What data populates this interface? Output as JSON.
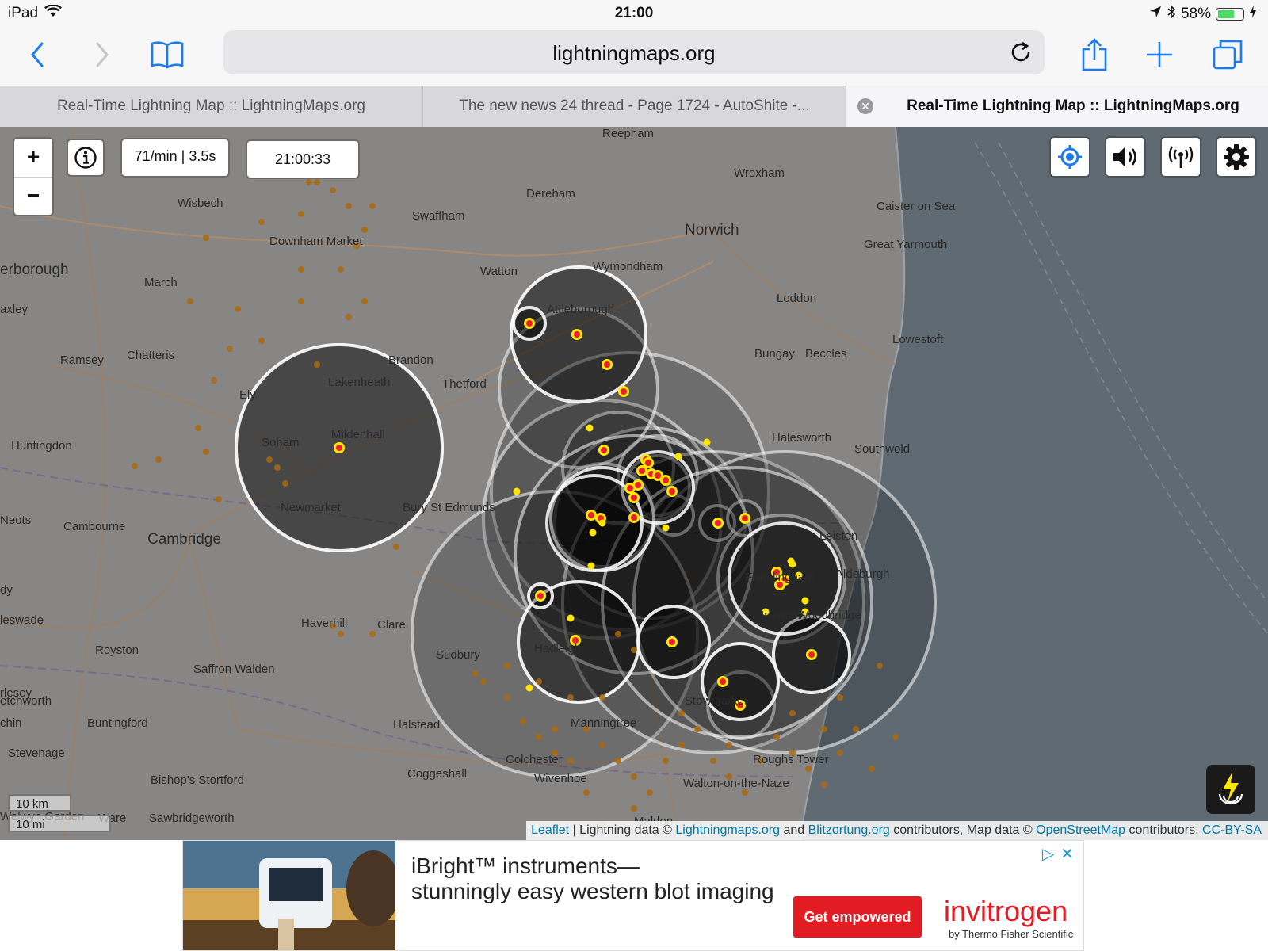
{
  "status_bar": {
    "device": "iPad",
    "time": "21:00",
    "battery_percent": "58%",
    "battery_level": 0.58
  },
  "toolbar": {
    "url": "lightningmaps.org"
  },
  "tabs": [
    {
      "label": "Real-Time Lightning Map :: LightningMaps.org",
      "active": false
    },
    {
      "label": "The new news 24 thread - Page 1724 - AutoShite -...",
      "active": false
    },
    {
      "label": "Real-Time Lightning Map :: LightningMaps.org",
      "active": true
    }
  ],
  "map": {
    "zoom_in_label": "+",
    "zoom_out_label": "−",
    "rate": "71/min | 3.5s",
    "clock": "21:00:33",
    "scale_km": "10 km",
    "scale_mi": "10 mi",
    "place_labels": [
      "Reepham",
      "Wroxham",
      "Wisbech",
      "Dereham",
      "Swaffham",
      "Caister on Sea",
      "Norwich",
      "Great Yarmouth",
      "Downham Market",
      "erborough",
      "March",
      "Watton",
      "Wymondham",
      "Loddon",
      "Attleborough",
      "axley",
      "Ramsey",
      "Chatteris",
      "Brandon",
      "Bungay",
      "Beccles",
      "Lowestoft",
      "Lakenheath",
      "Thetford",
      "Halesworth",
      "Ely",
      "Huntingdon",
      "Mildenhall",
      "Soham",
      "Southwold",
      "Neots",
      "Cambourne",
      "Newmarket",
      "Bury St Edmunds",
      "Cambridge",
      "Leiston",
      "dy",
      "Aldeburgh",
      "Haverhill",
      "Clare",
      "Woodbridge",
      "leswade",
      "Royston",
      "Sudbury",
      "Hadleigh",
      "Saffron Walden",
      "rlesey",
      "etchworth",
      "chin",
      "Buntingford",
      "Halstead",
      "Manningtree",
      "Stevenage",
      "Colchester",
      "Roughs Tower",
      "Coggeshall",
      "Wivenhoe",
      "Bishop's Stortford",
      "Walton-on-the-Naze",
      "Welwyn Garden",
      "Ware",
      "Sawbridgeworth",
      "Maldon",
      "Stowmarket",
      "Framlingham",
      "Ipswich"
    ]
  },
  "attribution": {
    "leaflet": "Leaflet",
    "sep": " | Lightning data © ",
    "lm": "Lightningmaps.org",
    "and": " and ",
    "bz": "Blitzortung.org",
    "contrib": " contributors, Map data © ",
    "osm": "OpenStreetMap",
    "contrib2": " contributors, ",
    "license": "CC-BY-SA"
  },
  "ad": {
    "headline1": "iBright™ instruments—",
    "headline2": "stunningly easy western blot imaging",
    "cta": "Get empowered",
    "brand": "invitrogen",
    "brand_sub": "by Thermo Fisher Scientific"
  },
  "colors": {
    "ios_blue": "#1a7cf0",
    "strike_red": "#e8202a",
    "strike_yellow": "#ffe600",
    "old_strike": "#a86a10",
    "map_land": "#878685",
    "map_sea": "#5f6a72"
  }
}
